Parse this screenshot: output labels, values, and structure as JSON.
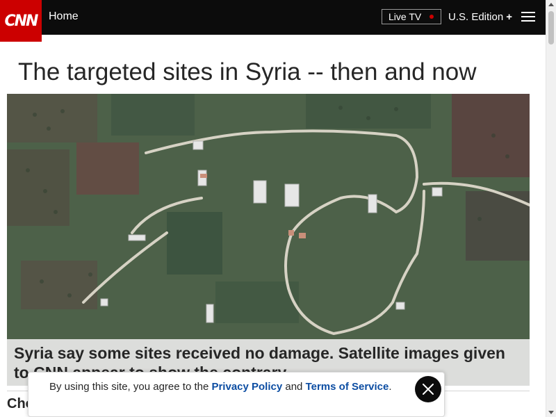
{
  "header": {
    "logo_text": "CNN",
    "home_label": "Home",
    "live_tv_label": "Live TV",
    "edition_label": "U.S. Edition",
    "edition_plus": "+",
    "menu_icon": "hamburger-menu-icon",
    "colors": {
      "bar": "#0c0c0c",
      "logo": "#cc0000",
      "live_dot": "#cc0000"
    }
  },
  "article": {
    "headline": "The targeted sites in Syria -- then and now",
    "image_caption": "Syria say some sites received no damage. Satellite images given to CNN appear to show the contrary",
    "below_text": "Cho"
  },
  "consent": {
    "prefix": "By using this site, you agree to the ",
    "privacy_link": "Privacy Policy",
    "conjunction": " and ",
    "terms_link": "Terms of Service",
    "suffix": ".",
    "close_icon": "close-icon",
    "link_color": "#0c4da2"
  }
}
